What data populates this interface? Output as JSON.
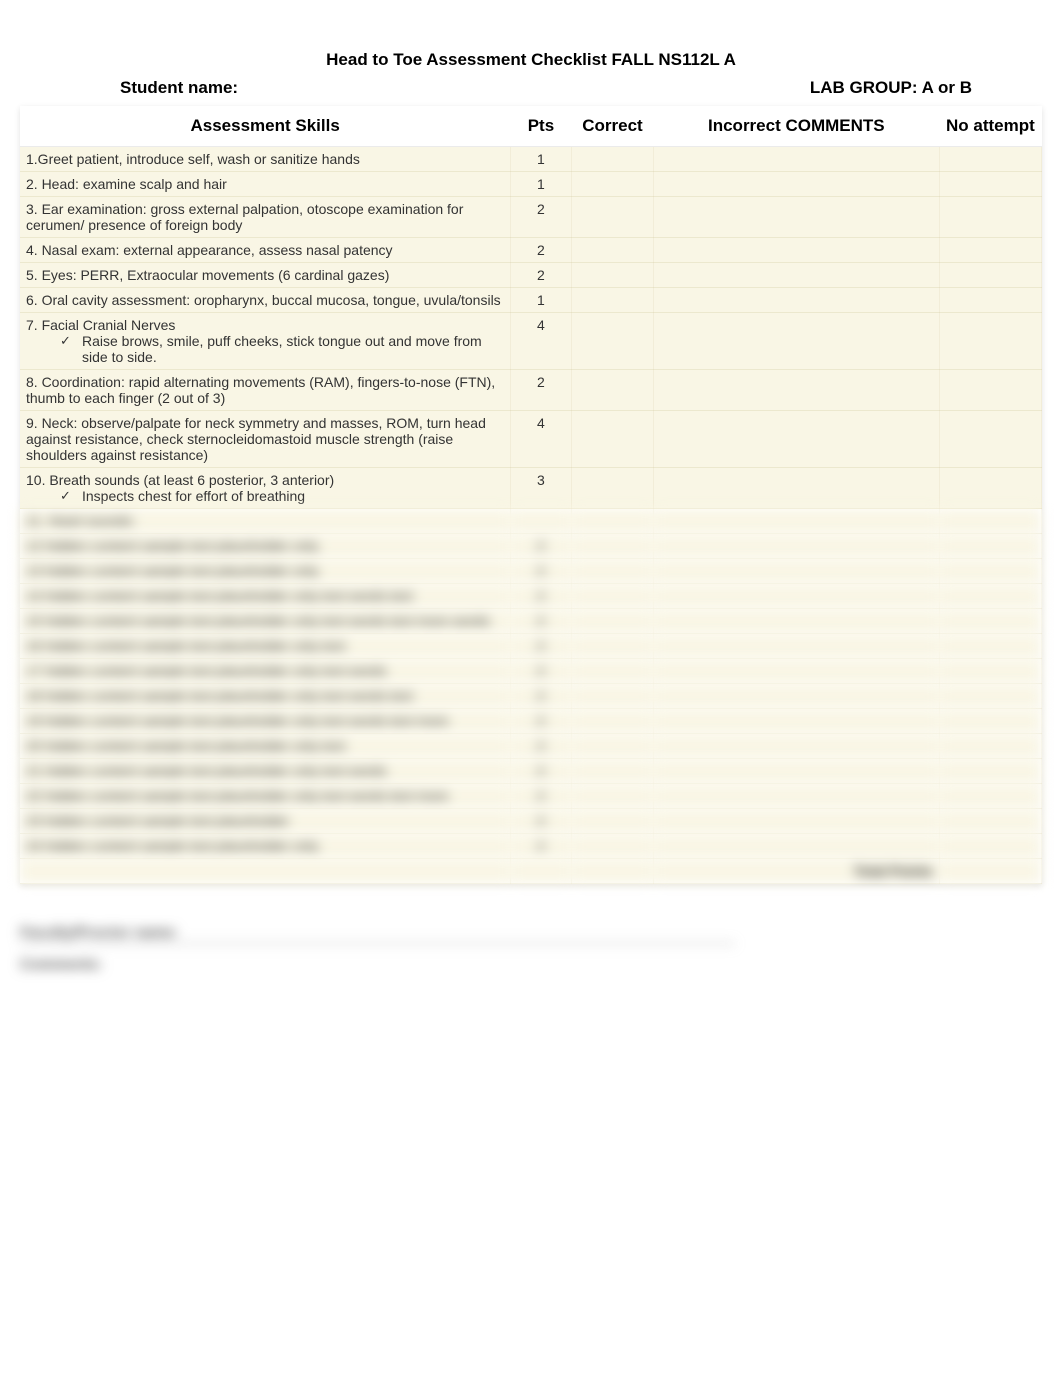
{
  "title": "Head to Toe Assessment Checklist FALL NS112L A",
  "student_label": "Student name:",
  "lab_group_label": "LAB GROUP:     A     or      B",
  "columns": {
    "skills": "Assessment Skills",
    "pts": "Pts",
    "correct": "Correct",
    "incorrect": "Incorrect COMMENTS",
    "noattempt": "No attempt"
  },
  "rows": [
    {
      "skill": "1.Greet patient, introduce self, wash or sanitize hands",
      "pts": "1"
    },
    {
      "skill": "2. Head:  examine scalp and hair",
      "pts": "1"
    },
    {
      "skill": "3. Ear examination: gross external palpation, otoscope examination for cerumen/ presence of foreign body",
      "pts": "2"
    },
    {
      "skill": "4. Nasal exam: external appearance, assess nasal patency",
      "pts": "2"
    },
    {
      "skill": "5. Eyes:  PERR, Extraocular movements (6 cardinal gazes)",
      "pts": "2"
    },
    {
      "skill": "6. Oral cavity assessment: oropharynx, buccal mucosa, tongue, uvula/tonsils",
      "pts": "1"
    },
    {
      "skill": "7. Facial Cranial Nerves",
      "pts": "4",
      "sub": "Raise brows, smile, puff cheeks, stick tongue out and move from side to side.",
      "check": true
    },
    {
      "skill": "8. Coordination: rapid alternating movements (RAM), fingers-to-nose (FTN), thumb to each finger (2 out of 3)",
      "pts": "2"
    },
    {
      "skill": "9.  Neck:  observe/palpate for neck symmetry and masses, ROM, turn head against resistance, check sternocleidomastoid muscle strength (raise shoulders against resistance)",
      "pts": "4"
    },
    {
      "skill": "10. Breath sounds (at least 6 posterior, 3 anterior)",
      "pts": "3",
      "sub": "Inspects chest for effort of breathing",
      "check": true
    },
    {
      "skill": "11. Heart sounds:",
      "pts": ""
    }
  ],
  "blurred_rows": [
    {
      "skill": "12 hidden content sample text placeholder only",
      "pts": "2"
    },
    {
      "skill": "13 hidden content sample text placeholder only",
      "pts": "2"
    },
    {
      "skill": "14 hidden content sample text placeholder only text words text",
      "pts": "2"
    },
    {
      "skill": "15 hidden content sample text placeholder only text words text more words",
      "pts": "2"
    },
    {
      "skill": "16 hidden content sample text placeholder only text",
      "pts": "2"
    },
    {
      "skill": "17 hidden content sample text placeholder only text words",
      "pts": "2"
    },
    {
      "skill": "18 hidden content sample text placeholder only text words text",
      "pts": "2"
    },
    {
      "skill": "19 hidden content sample text placeholder only text words text more",
      "pts": "2"
    },
    {
      "skill": "20 hidden content sample text placeholder only text",
      "pts": "2"
    },
    {
      "skill": "21 hidden content sample text placeholder only text words",
      "pts": "2"
    },
    {
      "skill": "22 hidden content sample text placeholder only text words text more",
      "pts": "2"
    },
    {
      "skill": "23 hidden content sample text placeholder",
      "pts": "2"
    },
    {
      "skill": "24 hidden content sample text placeholder only",
      "pts": "2"
    },
    {
      "skill": "",
      "pts": "",
      "totals": "Total Points"
    }
  ],
  "footer": {
    "line1": "Faculty/Proctor name:",
    "line2": "Comments:"
  }
}
